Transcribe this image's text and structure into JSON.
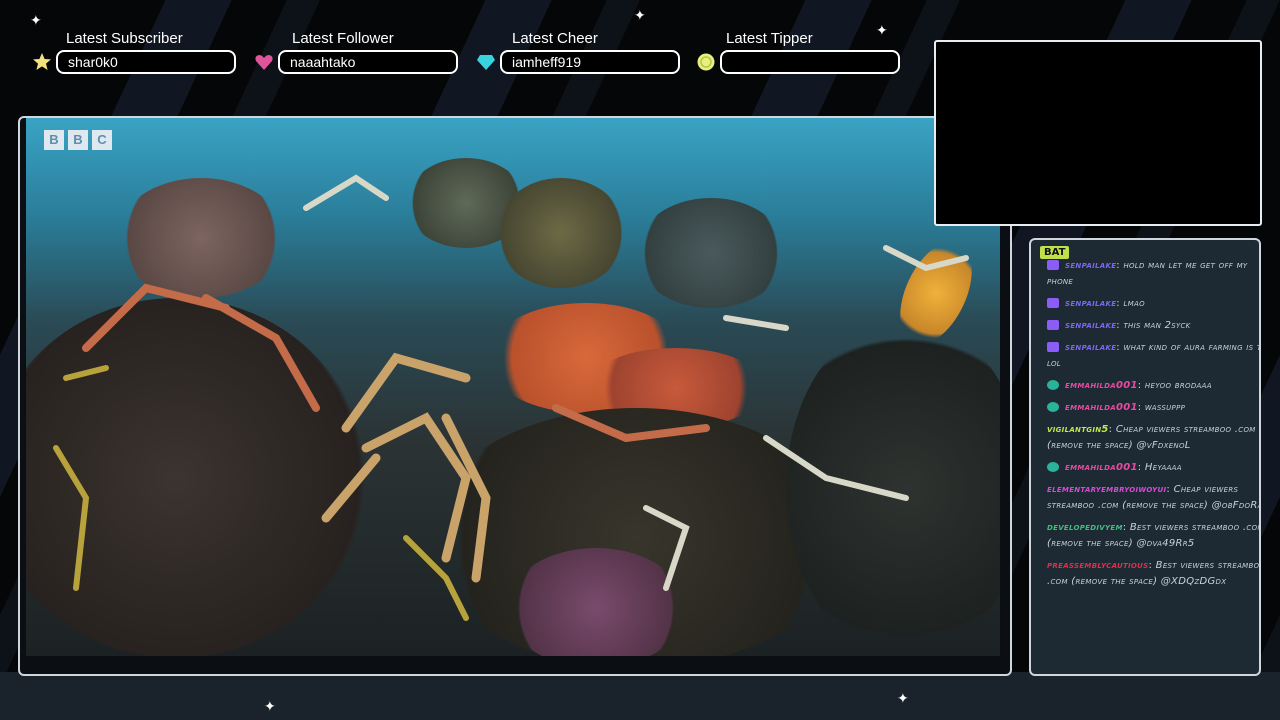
{
  "stats": [
    {
      "title": "Latest Subscriber",
      "value": "shar0k0",
      "icon": "star-icon",
      "color": "#f3e37a"
    },
    {
      "title": "Latest Follower",
      "value": "naaahtako",
      "icon": "heart-icon",
      "color": "#e0559a"
    },
    {
      "title": "Latest Cheer",
      "value": "iamheff919",
      "icon": "gem-icon",
      "color": "#39d3e0"
    },
    {
      "title": "Latest Tipper",
      "value": "",
      "icon": "coin-icon",
      "color": "#e6f07a"
    }
  ],
  "video": {
    "watermark": [
      "B",
      "B",
      "C"
    ]
  },
  "chat": {
    "overlay_tag": "BAT",
    "messages": [
      {
        "user": "senpailake",
        "text": "hold man let me get off my phone",
        "badge_color": "#8b5cf6",
        "user_color": "#7b68ee"
      },
      {
        "user": "senpailake",
        "text": "lmao",
        "badge_color": "#8b5cf6",
        "user_color": "#7b68ee"
      },
      {
        "user": "senpailake",
        "text": "this man 2syck",
        "badge_color": "#8b5cf6",
        "user_color": "#7b68ee"
      },
      {
        "user": "senpailake",
        "text": "what kind of aura farming is this lol",
        "badge_color": "#8b5cf6",
        "user_color": "#7b68ee"
      },
      {
        "user": "emmahilda001",
        "text": "heyoo brodaaa",
        "badge_color": "#2bb39a",
        "user_color": "#e54ca0"
      },
      {
        "user": "emmahilda001",
        "text": "wassuppp",
        "badge_color": "#2bb39a",
        "user_color": "#e54ca0"
      },
      {
        "user": "vigilantgin5",
        "text": "Cheap viewers streamboo .com (remove the space) @vFdxenoL",
        "badge_color": "",
        "user_color": "#c6e84a"
      },
      {
        "user": "emmahilda001",
        "text": "Heyaaaa",
        "badge_color": "#2bb39a",
        "user_color": "#e54ca0"
      },
      {
        "user": "elementaryembryoiwoyui",
        "text": "Cheap viewers streamboo .com (remove the space) @obFdoRaZ",
        "badge_color": "",
        "user_color": "#d84ad8"
      },
      {
        "user": "developedivyem",
        "text": "Best viewers streamboo .com (remove the space) @dva49Rr5",
        "badge_color": "",
        "user_color": "#3fbf7f"
      },
      {
        "user": "preassemblycautious",
        "text": "Best viewers streamboo .com (remove the space) @XDQzDGdx",
        "badge_color": "",
        "user_color": "#e0304a"
      }
    ]
  }
}
